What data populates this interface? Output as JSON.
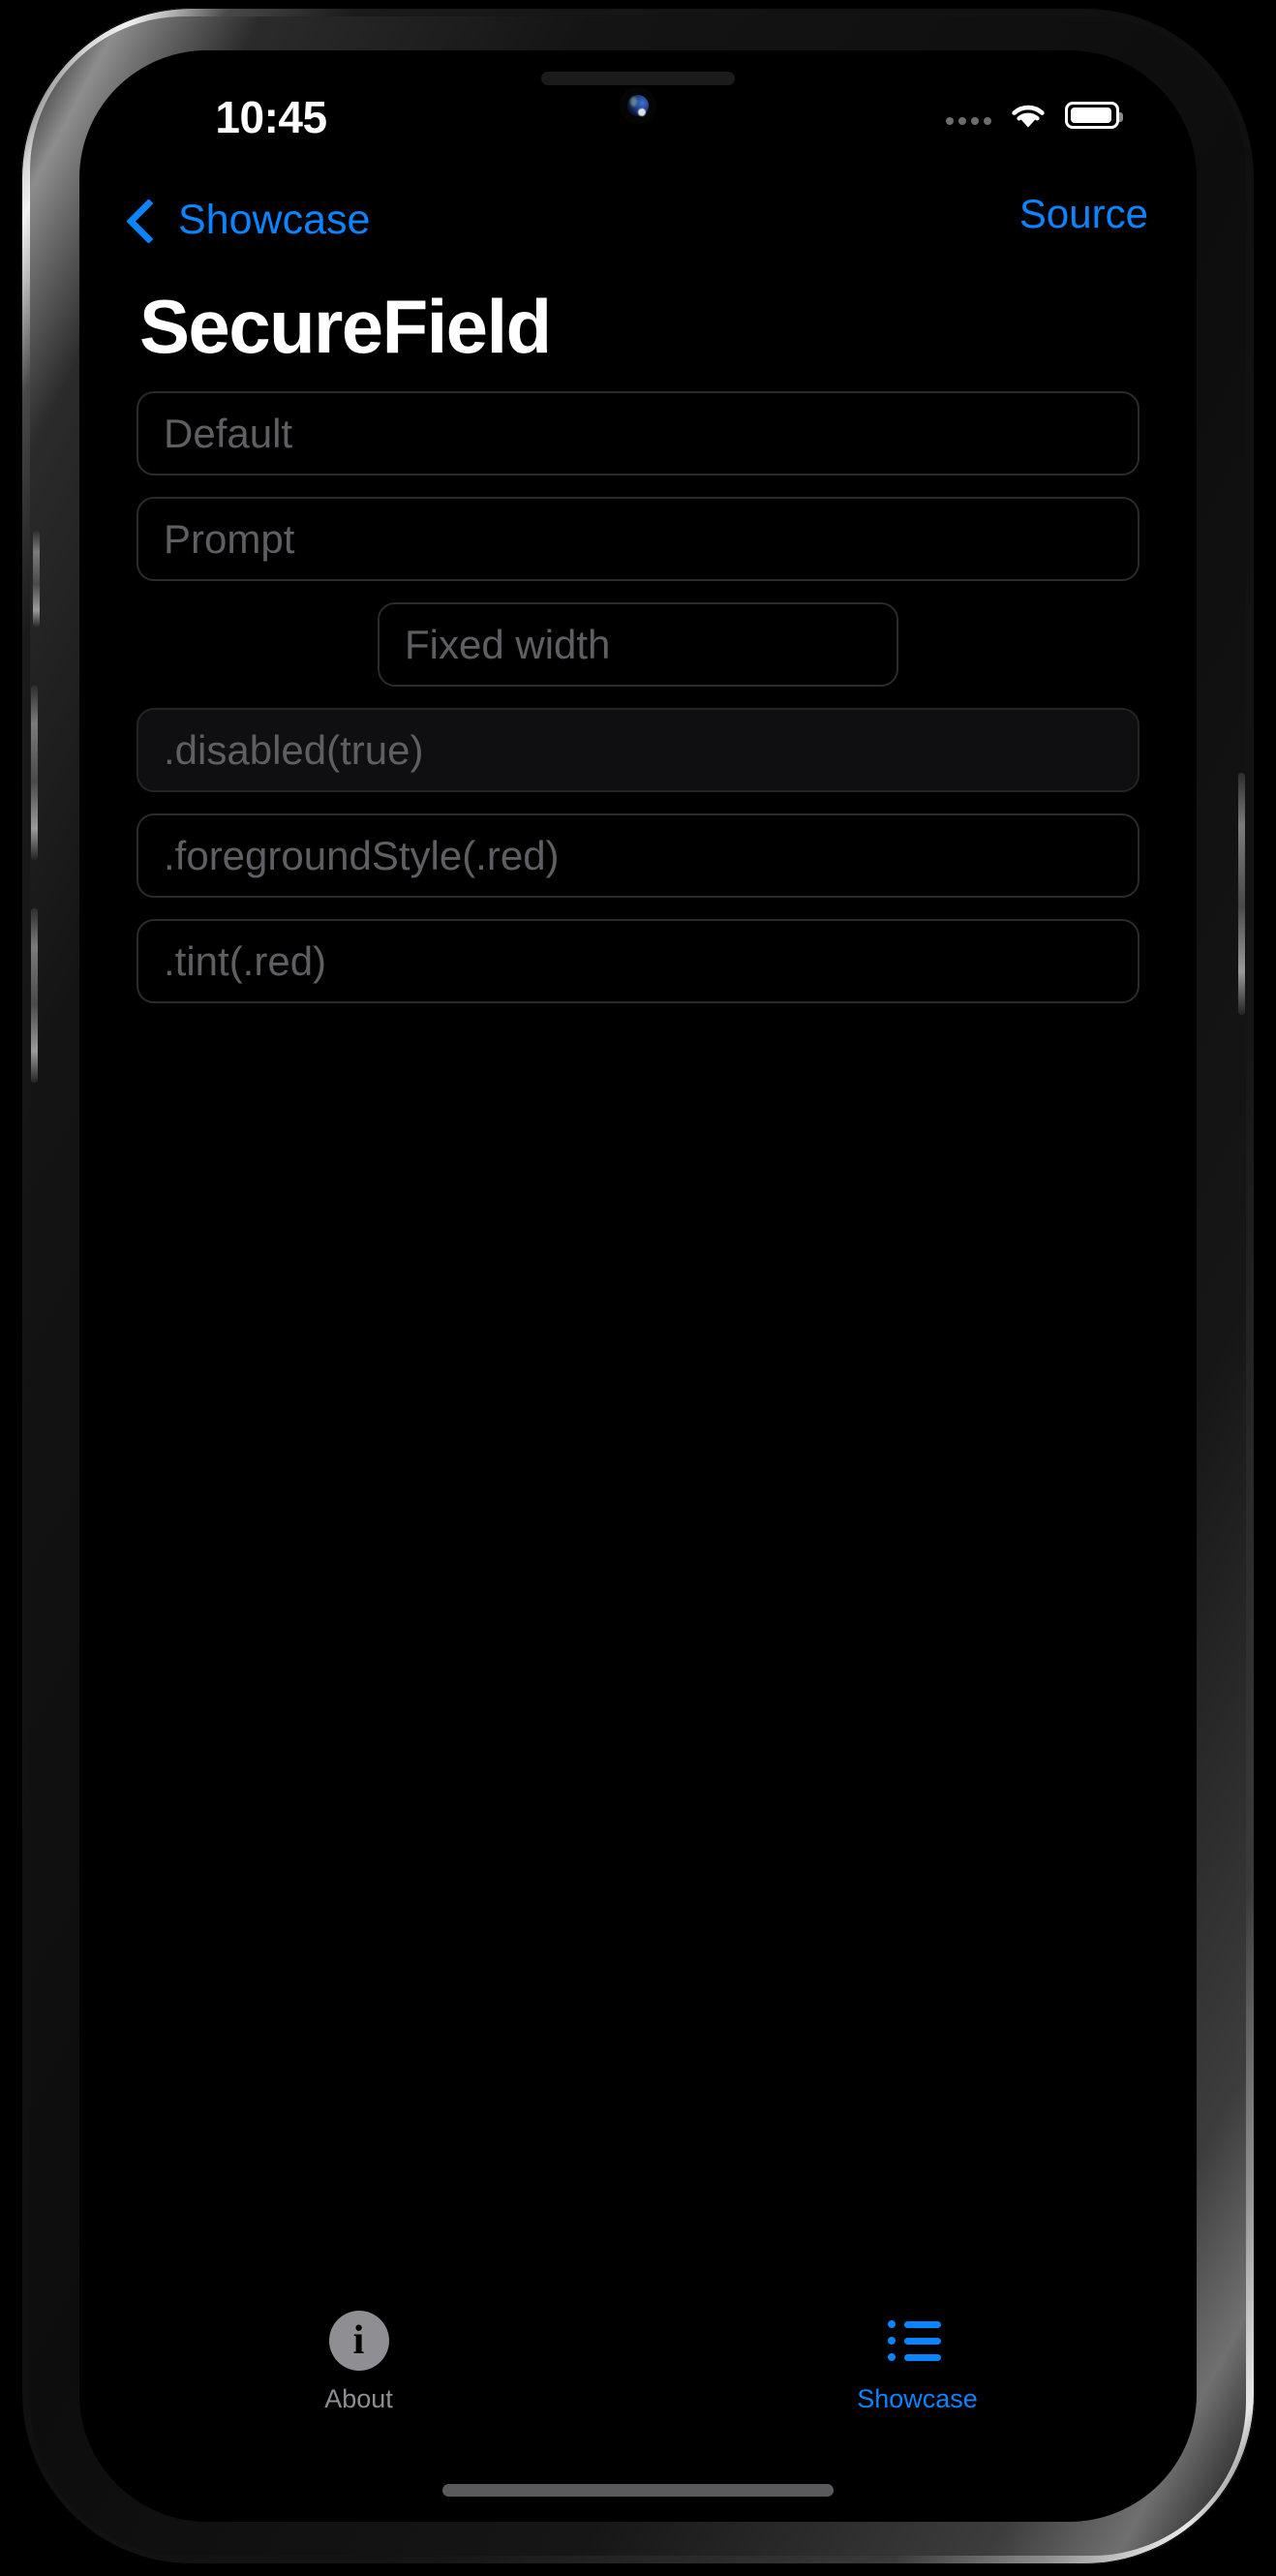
{
  "status_bar": {
    "time": "10:45",
    "cellular_icon": "cellular-dots-icon",
    "wifi_icon": "wifi-icon",
    "battery_icon": "battery-full-icon"
  },
  "nav": {
    "back_label": "Showcase",
    "back_icon": "chevron-left-icon",
    "trailing_label": "Source",
    "accent_color": "#0A84FF"
  },
  "page": {
    "title": "SecureField"
  },
  "fields": [
    {
      "placeholder": "Default",
      "value": "",
      "variant": "outline",
      "width": "full"
    },
    {
      "placeholder": "Prompt",
      "value": "",
      "variant": "outline",
      "width": "full"
    },
    {
      "placeholder": "Fixed width",
      "value": "",
      "variant": "outline",
      "width": "fixed"
    },
    {
      "placeholder": ".disabled(true)",
      "value": "",
      "variant": "filled",
      "width": "full"
    },
    {
      "placeholder": ".foregroundStyle(.red)",
      "value": "",
      "variant": "outline",
      "width": "full"
    },
    {
      "placeholder": ".tint(.red)",
      "value": "",
      "variant": "outline",
      "width": "full"
    }
  ],
  "tabbar": {
    "items": [
      {
        "label": "About",
        "icon": "info-circle-icon",
        "active": false
      },
      {
        "label": "Showcase",
        "icon": "list-bullet-icon",
        "active": true
      }
    ]
  }
}
